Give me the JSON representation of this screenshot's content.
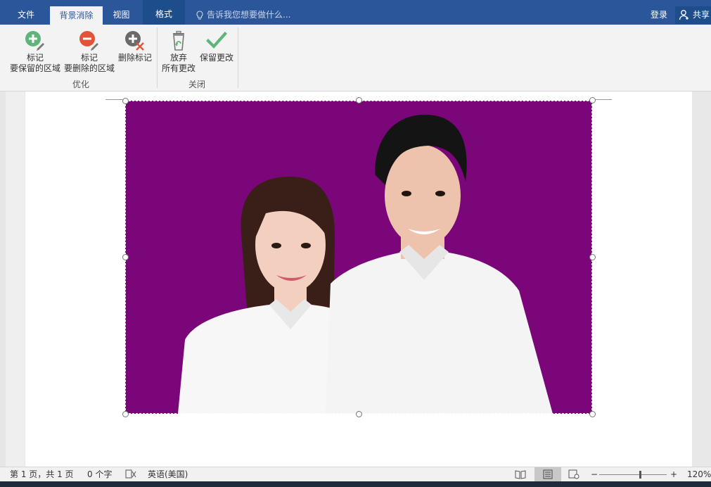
{
  "tabs": {
    "file": "文件",
    "background_removal": "背景消除",
    "view": "视图",
    "format": "格式"
  },
  "search": {
    "placeholder": "告诉我您想要做什么..."
  },
  "account": {
    "login": "登录",
    "share": "共享"
  },
  "ribbon": {
    "mark_keep_line1": "标记",
    "mark_keep_line2": "要保留的区域",
    "mark_remove_line1": "标记",
    "mark_remove_line2": "要删除的区域",
    "delete_mark": "删除标记",
    "discard_line1": "放弃",
    "discard_line2": "所有更改",
    "keep_changes": "保留更改",
    "group_refine": "优化",
    "group_close": "关闭"
  },
  "statusbar": {
    "page": "第 1 页，共 1 页",
    "words": "0 个字",
    "language": "英语(美国)",
    "zoom": "120%",
    "zoom_level": 0.6
  },
  "colors": {
    "title_blue": "#2b579a",
    "photo_bg": "#7a067a",
    "add_green": "#5fb47a",
    "remove_red": "#e2543a"
  }
}
